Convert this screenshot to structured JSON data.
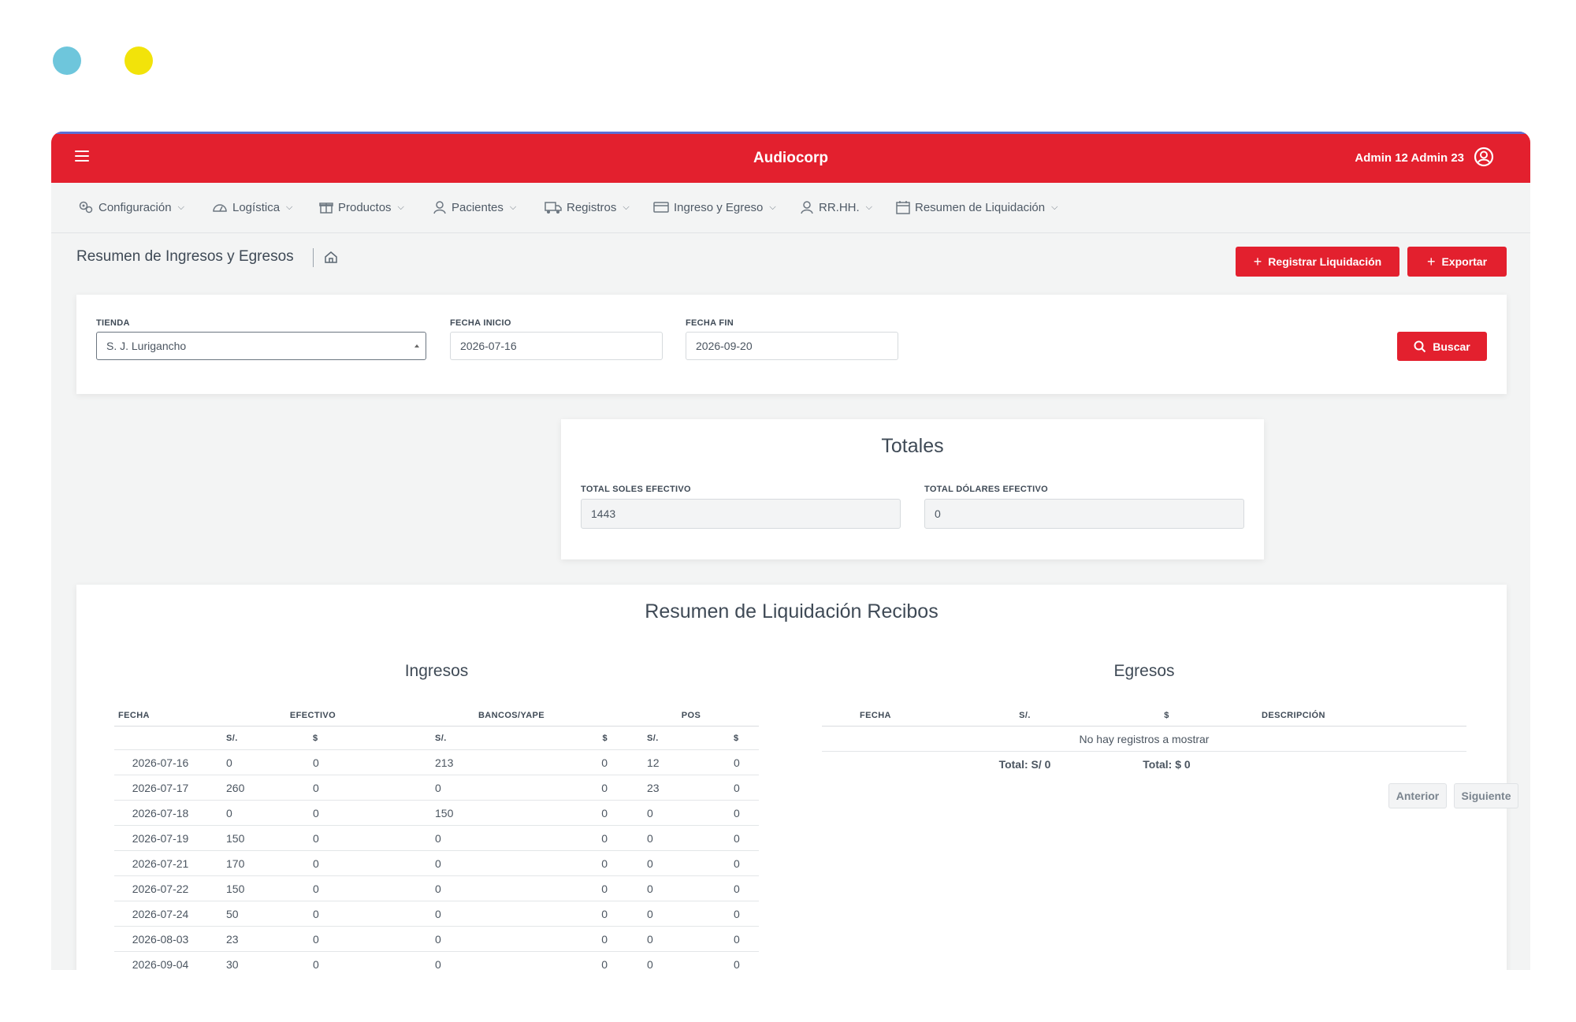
{
  "app": {
    "brand": "Audiocorp",
    "user": "Admin 12 Admin 23"
  },
  "nav": [
    {
      "label": "Configuración",
      "icon": "gears-icon"
    },
    {
      "label": "Logística",
      "icon": "gauge-icon"
    },
    {
      "label": "Productos",
      "icon": "gift-icon"
    },
    {
      "label": "Pacientes",
      "icon": "user-icon"
    },
    {
      "label": "Registros",
      "icon": "truck-icon"
    },
    {
      "label": "Ingreso y Egreso",
      "icon": "card-icon"
    },
    {
      "label": "RR.HH.",
      "icon": "user-icon"
    },
    {
      "label": "Resumen de Liquidación",
      "icon": "calendar-icon"
    }
  ],
  "page": {
    "title": "Resumen de Ingresos y Egresos",
    "btn_registrar": "Registrar Liquidación",
    "btn_exportar": "Exportar"
  },
  "filters": {
    "tienda_label": "TIENDA",
    "tienda_value": "S. J. Lurigancho",
    "fecha_inicio_label": "FECHA INICIO",
    "fecha_inicio_value": "2026-07-16",
    "fecha_fin_label": "FECHA FIN",
    "fecha_fin_value": "2026-09-20",
    "buscar_label": "Buscar"
  },
  "totales": {
    "title": "Totales",
    "soles_label": "TOTAL SOLES EFECTIVO",
    "soles_value": "1443",
    "dolares_label": "TOTAL DÓLARES EFECTIVO",
    "dolares_value": "0"
  },
  "resumen": {
    "title": "Resumen de Liquidación Recibos",
    "ingresos": {
      "title": "Ingresos",
      "headers": [
        "FECHA",
        "EFECTIVO",
        "BANCOS/YAPE",
        "POS"
      ],
      "subheaders": [
        "S/.",
        "$",
        "S/.",
        "$",
        "S/.",
        "$"
      ],
      "rows": [
        [
          "2026-07-16",
          "0",
          "0",
          "213",
          "0",
          "12",
          "0"
        ],
        [
          "2026-07-17",
          "260",
          "0",
          "0",
          "0",
          "23",
          "0"
        ],
        [
          "2026-07-18",
          "0",
          "0",
          "150",
          "0",
          "0",
          "0"
        ],
        [
          "2026-07-19",
          "150",
          "0",
          "0",
          "0",
          "0",
          "0"
        ],
        [
          "2026-07-21",
          "170",
          "0",
          "0",
          "0",
          "0",
          "0"
        ],
        [
          "2026-07-22",
          "150",
          "0",
          "0",
          "0",
          "0",
          "0"
        ],
        [
          "2026-07-24",
          "50",
          "0",
          "0",
          "0",
          "0",
          "0"
        ],
        [
          "2026-08-03",
          "23",
          "0",
          "0",
          "0",
          "0",
          "0"
        ],
        [
          "2026-09-04",
          "30",
          "0",
          "0",
          "0",
          "0",
          "0"
        ]
      ]
    },
    "egresos": {
      "title": "Egresos",
      "headers": [
        "FECHA",
        "S/.",
        "$",
        "DESCRIPCIÓN"
      ],
      "empty": "No hay registros a mostrar",
      "total_soles": "Total: S/ 0",
      "total_dolares": "Total: $ 0",
      "btn_anterior": "Anterior",
      "btn_siguiente": "Siguiente"
    }
  }
}
